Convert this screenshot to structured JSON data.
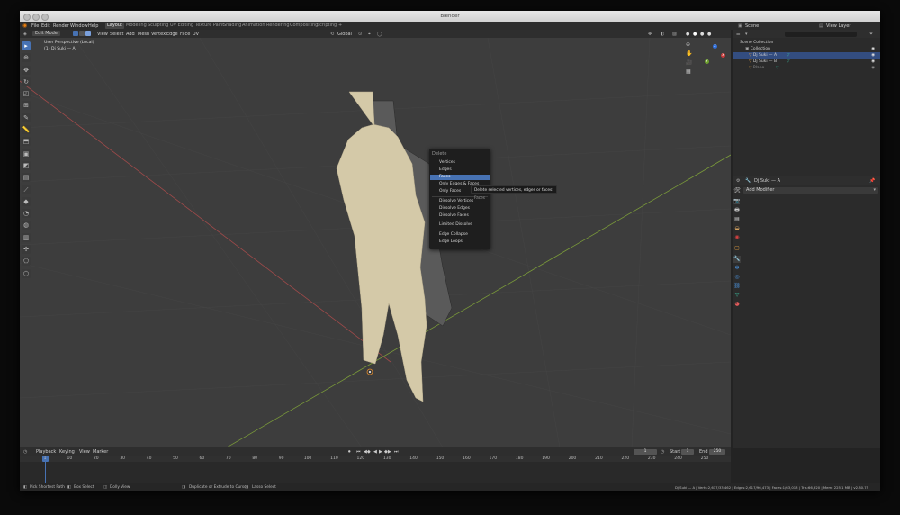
{
  "window": {
    "title": "Blender"
  },
  "menu": {
    "items": [
      "File",
      "Edit",
      "Render",
      "Window",
      "Help"
    ],
    "workspaces": [
      "Layout",
      "Modeling",
      "Sculpting",
      "UV Editing",
      "Texture Paint",
      "Shading",
      "Animation",
      "Rendering",
      "Compositing",
      "Scripting"
    ],
    "plus": "+",
    "scene_label": "Scene",
    "view_layer_label": "View Layer"
  },
  "viewport_header": {
    "mode": "Edit Mode",
    "menus": [
      "View",
      "Select",
      "Add",
      "Mesh",
      "Vertex",
      "Edge",
      "Face",
      "UV"
    ],
    "orientation": "Global"
  },
  "viewport": {
    "view_name": "User Perspective (Local)",
    "object_name": "(1) Dj Suki — A",
    "tool_icons": [
      "select-box",
      "cursor",
      "move",
      "rotate",
      "scale",
      "transform",
      "annotate",
      "measure",
      "extrude",
      "inset",
      "bevel",
      "loop-cut",
      "knife",
      "poly-build",
      "spin",
      "smooth",
      "edge-slide",
      "shrink-fatten",
      "shear",
      "rip"
    ],
    "gizmo_axes": [
      "X",
      "Y",
      "Z"
    ],
    "colors": {
      "bg": "#3d3d3d",
      "grid_x": "#a04a4a",
      "grid_y": "#7a9a3a",
      "mesh_face": "#d4c9a8",
      "accent": "#4772b3"
    }
  },
  "context_menu": {
    "title": "Delete",
    "items": [
      "Vertices",
      "Edges",
      "Faces",
      "Only Edges & Faces",
      "Only Faces",
      "Dissolve Vertices",
      "Dissolve Edges",
      "Dissolve Faces",
      "Limited Dissolve",
      "Edge Collapse",
      "Edge Loops"
    ],
    "selected": "Faces",
    "tooltip": "Delete selected vertices, edges or faces:",
    "tooltip_value": "Faces"
  },
  "outliner": {
    "search_placeholder": "",
    "rows": [
      "Scene Collection",
      "Collection",
      "Dj Suki — A",
      "Dj Suki — B",
      "Plane"
    ]
  },
  "properties": {
    "object_name": "Dj Suki — A",
    "add_modifier": "Add Modifier"
  },
  "timeline": {
    "menus": [
      "Playback",
      "Keying",
      "View",
      "Marker"
    ],
    "current_frame": "1",
    "start_label": "Start",
    "start": "1",
    "end_label": "End",
    "end": "250",
    "ticks": [
      "1",
      "10",
      "20",
      "30",
      "40",
      "50",
      "60",
      "70",
      "80",
      "90",
      "100",
      "110",
      "120",
      "130",
      "140",
      "150",
      "160",
      "170",
      "180",
      "190",
      "200",
      "210",
      "220",
      "230",
      "240",
      "250"
    ]
  },
  "status_bar": {
    "pick": "Pick Shortest Path",
    "box": "Box Select",
    "dolly": "Dolly View",
    "duplicate": "Duplicate or Extrude to Cursor",
    "lasso": "Lasso Select",
    "stats": "Dj Suki — A | Verts:2,617/33,462 | Edges:2,617/96,473 | Faces:1/63,013 | Tris:66,920 | Mem: 225.1 MB | v2.80.75"
  }
}
